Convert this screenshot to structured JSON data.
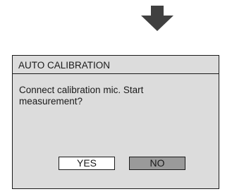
{
  "dialog": {
    "title": "AUTO CALIBRATION",
    "message": "Connect calibration mic. Start measurement?",
    "buttons": {
      "yes_label": "YES",
      "no_label": "NO"
    },
    "selected_button": "NO"
  },
  "icons": {
    "top": "down-arrow-icon"
  },
  "colors": {
    "dialog_background": "#dcdcdc",
    "selected_button": "#9a9a9a",
    "unselected_button": "#ffffff",
    "border": "#1a1a1a"
  }
}
